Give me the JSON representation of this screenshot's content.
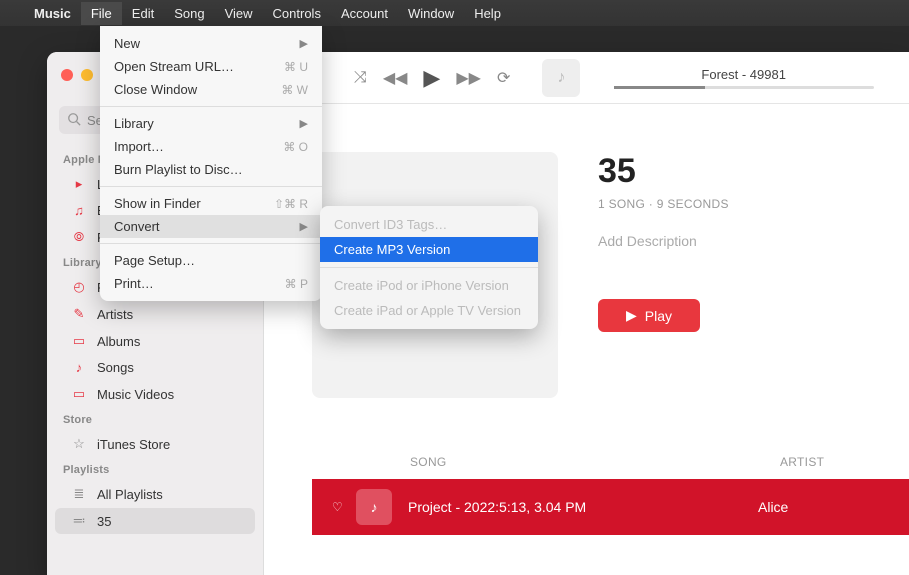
{
  "menubar": {
    "app": "Music",
    "items": [
      "File",
      "Edit",
      "Song",
      "View",
      "Controls",
      "Account",
      "Window",
      "Help"
    ]
  },
  "file_menu": {
    "new": "New",
    "open_stream": "Open Stream URL…",
    "open_stream_sc": "⌘ U",
    "close_window": "Close Window",
    "close_window_sc": "⌘ W",
    "library": "Library",
    "import": "Import…",
    "import_sc": "⌘ O",
    "burn": "Burn Playlist to Disc…",
    "show_finder": "Show in Finder",
    "show_finder_sc": "⇧⌘ R",
    "convert": "Convert",
    "page_setup": "Page Setup…",
    "print": "Print…",
    "print_sc": "⌘ P"
  },
  "convert_menu": {
    "id3": "Convert ID3 Tags…",
    "mp3": "Create MP3 Version",
    "ipod": "Create iPod or iPhone Version",
    "ipad": "Create iPad or Apple TV Version"
  },
  "search": {
    "placeholder": "Sea"
  },
  "sidebar": {
    "apple_music": "Apple M",
    "am_items": [
      "Li",
      "Bi",
      "Ra"
    ],
    "library": "Library",
    "lib_items": [
      "Recently Added",
      "Artists",
      "Albums",
      "Songs",
      "Music Videos"
    ],
    "store": "Store",
    "store_items": [
      "iTunes Store"
    ],
    "playlists": "Playlists",
    "pl_items": [
      "All Playlists",
      "35"
    ]
  },
  "nowplaying": {
    "title": "Forest - 49981"
  },
  "album": {
    "title": "35",
    "meta": "1 SONG · 9 SECONDS",
    "desc": "Add Description",
    "play": "Play"
  },
  "table": {
    "col_song": "SONG",
    "col_artist": "ARTIST",
    "row_song": "Project - 2022:5:13, 3.04 PM",
    "row_artist": "Alice"
  }
}
